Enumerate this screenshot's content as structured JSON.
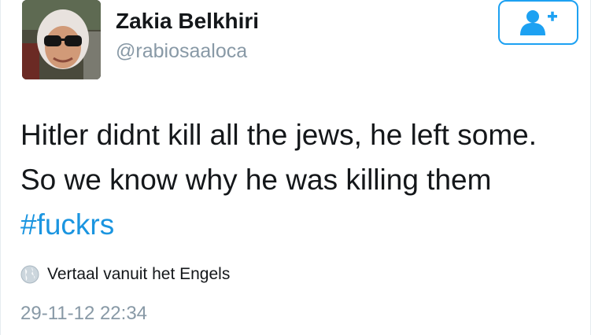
{
  "user": {
    "display_name": "Zakia Belkhiri",
    "handle": "@rabiosaaloca"
  },
  "follow_button": {
    "icon": "follow-user-plus-icon",
    "accent_color": "#1da1f2"
  },
  "tweet": {
    "text_line_1": "Hitler didnt kill all the jews, he left some.",
    "text_line_2": "So we know why he was killing them",
    "hashtag": "#fuckrs",
    "hashtag_color": "#1b95e0"
  },
  "translate": {
    "icon": "globe-icon",
    "label": "Vertaal vanuit het Engels"
  },
  "timestamp": "29-11-12 22:34",
  "colors": {
    "text": "#14171a",
    "secondary_text": "#8899a6"
  }
}
